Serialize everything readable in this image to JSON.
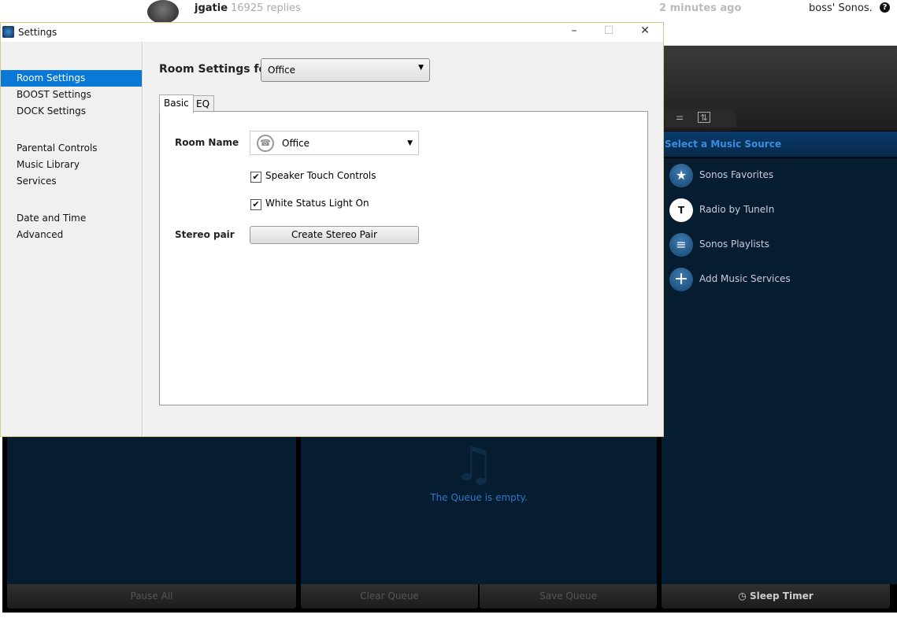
{
  "forum": {
    "username": "jgatie",
    "replies": "16925 replies",
    "time": "2 minutes ago",
    "owner": "boss' Sonos.",
    "help": "?"
  },
  "window": {
    "title": "Settings",
    "minimize": "–",
    "maximize": "☐",
    "close": "✕"
  },
  "sidebar": {
    "items": [
      {
        "label": "Room Settings"
      },
      {
        "label": "BOOST Settings"
      },
      {
        "label": "DOCK Settings"
      },
      {
        "label": "Parental Controls"
      },
      {
        "label": "Music Library"
      },
      {
        "label": "Services"
      },
      {
        "label": "Date and Time"
      },
      {
        "label": "Advanced"
      }
    ]
  },
  "main": {
    "heading": "Room Settings for",
    "room_select": "Office",
    "tabs": [
      {
        "label": "Basic"
      },
      {
        "label": "EQ"
      }
    ],
    "room_name_label": "Room Name",
    "room_name_value": "Office",
    "checkboxes": [
      {
        "label": "Speaker Touch Controls",
        "checked": true
      },
      {
        "label": "White Status Light On",
        "checked": true
      }
    ],
    "stereo_label": "Stereo pair",
    "stereo_button": "Create Stereo Pair"
  },
  "sonos": {
    "source_header": "Select a Music Source",
    "sources": [
      {
        "label": "Sonos Favorites",
        "icon": "★"
      },
      {
        "label": "Radio by TuneIn",
        "icon": "T"
      },
      {
        "label": "Sonos Playlists",
        "icon": "≡"
      },
      {
        "label": "Add Music Services",
        "icon": "+"
      }
    ],
    "queue_empty": "The Queue is empty.",
    "buttons": {
      "pause_all": "Pause All",
      "clear_queue": "Clear Queue",
      "save_queue": "Save Queue",
      "sleep_timer": "Sleep Timer"
    }
  }
}
